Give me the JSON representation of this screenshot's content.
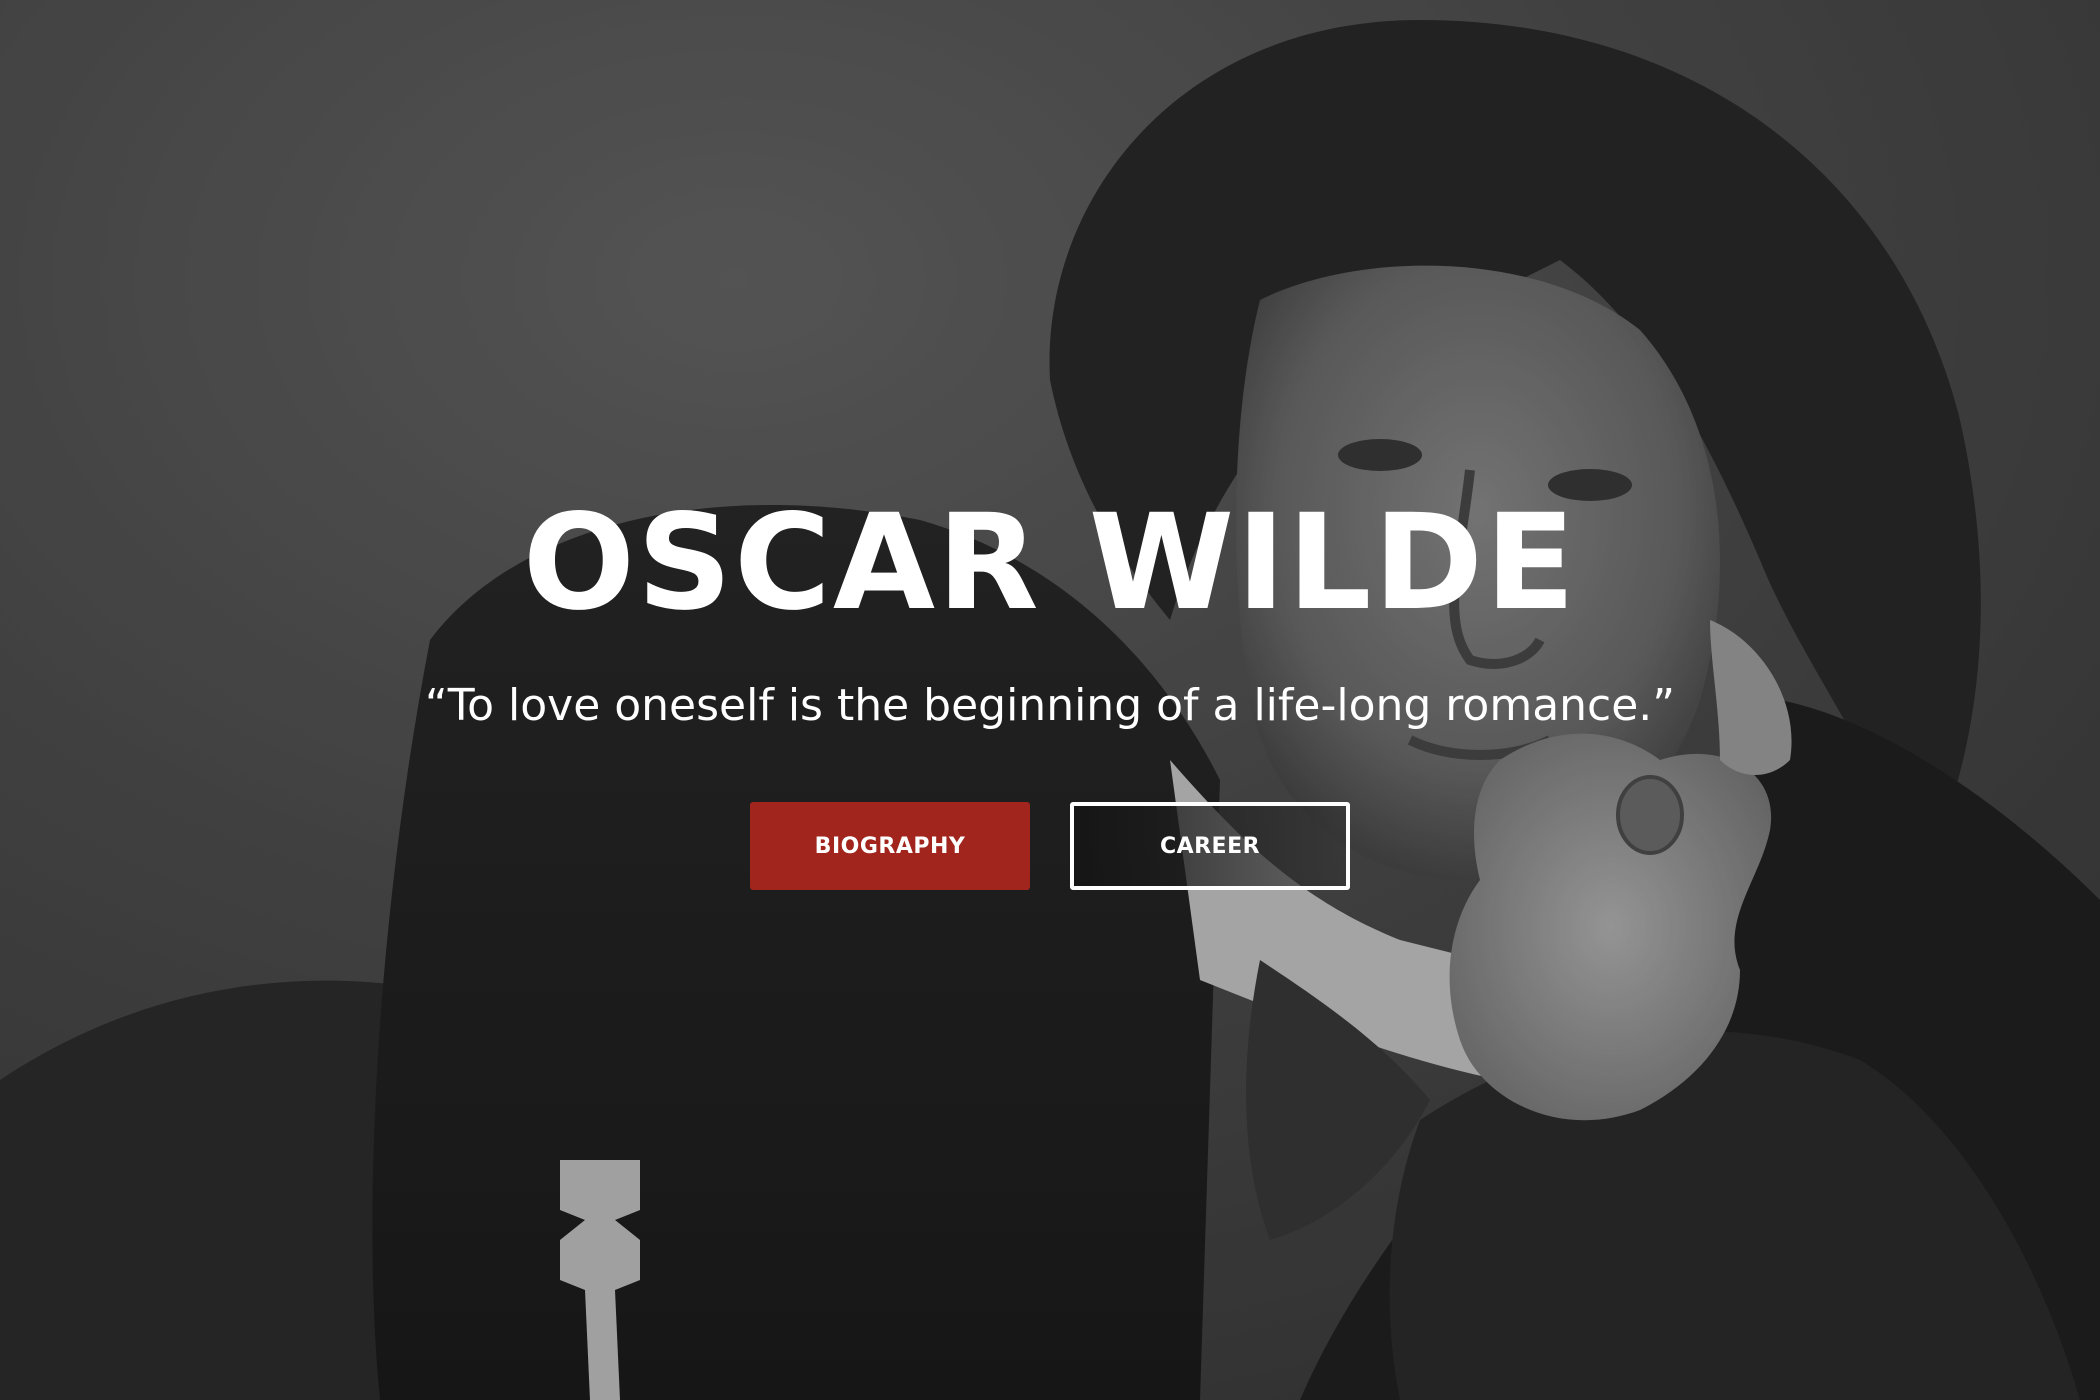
{
  "hero": {
    "title": "OSCAR WILDE",
    "quote": "“To love oneself is the beginning of a life-long romance.”",
    "image_subject": "sepia-toned portrait photograph of Oscar Wilde"
  },
  "buttons": {
    "biography_label": "BIOGRAPHY",
    "career_label": "CAREER"
  },
  "colors": {
    "accent": "#a1241d",
    "text": "#ffffff",
    "background": "#3a3a3a"
  }
}
